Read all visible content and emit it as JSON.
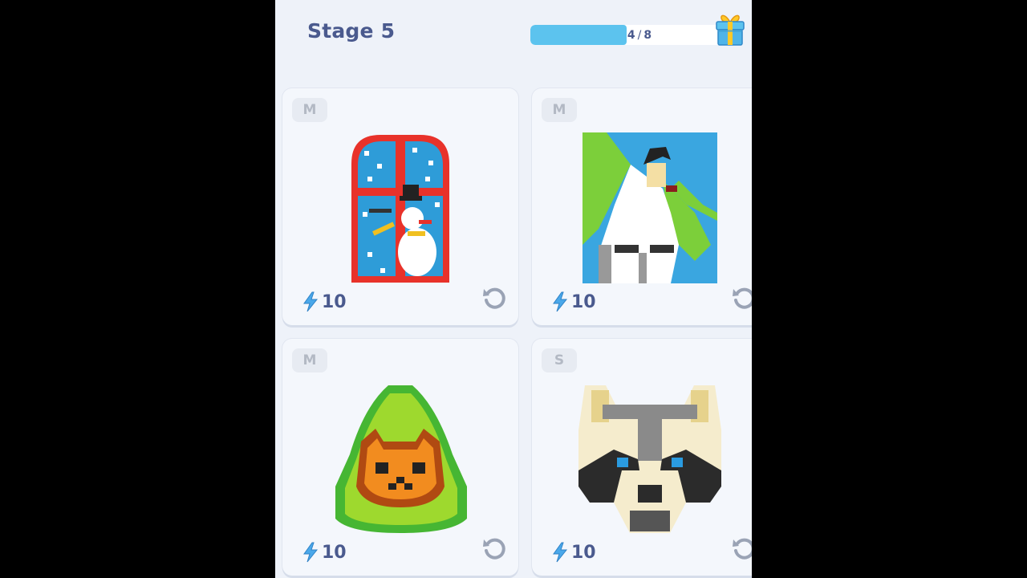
{
  "header": {
    "stage_title": "Stage 5",
    "progress": {
      "current": "4",
      "separator": "/",
      "total": "8",
      "fraction": 0.5
    }
  },
  "cards": [
    {
      "size": "M",
      "energy": "10",
      "art": "snowman-window-icon"
    },
    {
      "size": "M",
      "energy": "10",
      "art": "person-portrait-icon"
    },
    {
      "size": "M",
      "energy": "10",
      "art": "avocado-cat-icon"
    },
    {
      "size": "S",
      "energy": "10",
      "art": "raccoon-face-icon"
    }
  ],
  "colors": {
    "background": "#eef2f9",
    "progress_fill": "#5cc3ee",
    "text": "#4a5a8e",
    "lightning": "#4aa8ea"
  }
}
